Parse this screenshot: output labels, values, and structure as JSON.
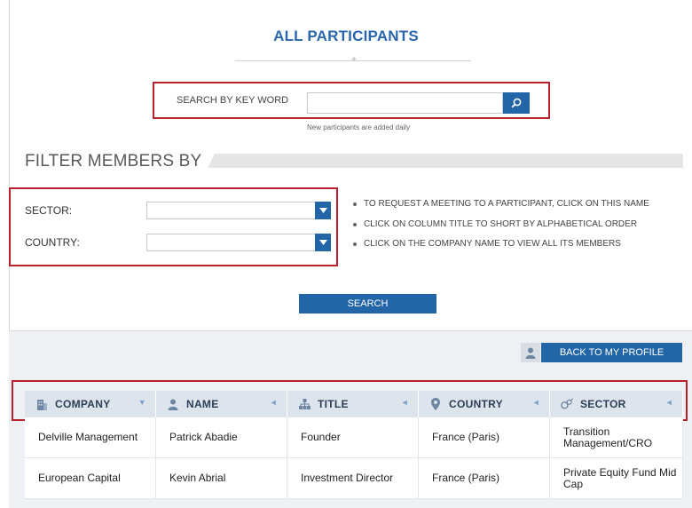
{
  "page": {
    "title": "ALL PARTICIPANTS"
  },
  "search": {
    "label": "SEARCH BY KEY WORD",
    "value": "",
    "placeholder": "",
    "hint": "New participants are added daily",
    "button_icon": "search-icon"
  },
  "filter": {
    "heading": "FILTER MEMBERS BY",
    "sector_label": "SECTOR:",
    "sector_value": "",
    "country_label": "COUNTRY:",
    "country_value": "",
    "dropdown_icon": "chevron-down-icon",
    "tips": [
      "TO REQUEST A MEETING TO A PARTICIPANT, CLICK ON THIS NAME",
      "CLICK ON COLUMN TITLE TO SHORT BY ALPHABETICAL ORDER",
      "CLICK ON THE COMPANY NAME TO VIEW ALL ITS MEMBERS"
    ],
    "submit_label": "SEARCH"
  },
  "profile": {
    "button_label": "BACK TO MY PROFILE",
    "icon": "user-icon"
  },
  "table": {
    "columns": [
      {
        "label": "COMPANY",
        "icon": "building-icon",
        "sort": "▼"
      },
      {
        "label": "NAME",
        "icon": "user-icon",
        "sort": "◄"
      },
      {
        "label": "TITLE",
        "icon": "org-chart-icon",
        "sort": "◄"
      },
      {
        "label": "COUNTRY",
        "icon": "location-pin-icon",
        "sort": "◄"
      },
      {
        "label": "SECTOR",
        "icon": "gender-symbols-icon",
        "sort": "◄"
      }
    ],
    "rows": [
      [
        "Delville Management",
        "Patrick Abadie",
        "Founder",
        "France (Paris)",
        "Transition Management/CRO"
      ],
      [
        "European Capital",
        "Kevin Abrial",
        "Investment Director",
        "France (Paris)",
        "Private Equity Fund Mid Cap"
      ]
    ]
  },
  "colors": {
    "accent": "#2366a8",
    "title": "#2a67ad",
    "highlight": "#b8202e",
    "header_bg": "#dde4ec"
  }
}
